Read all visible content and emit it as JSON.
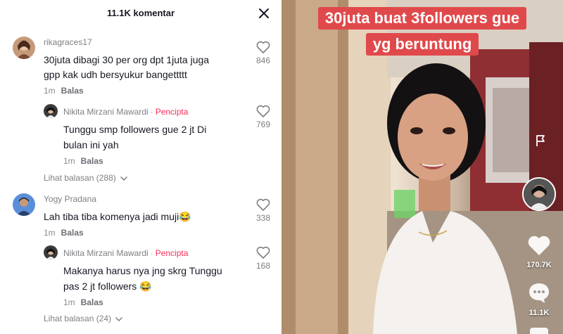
{
  "panel": {
    "title": "11.1K komentar"
  },
  "comments": [
    {
      "username": "rikagraces17",
      "text_line1": "30juta dibagi 30 per org dpt 1juta juga",
      "text_line2": "gpp kak udh bersyukur bangettttt",
      "age": "1m",
      "reply_label": "Balas",
      "likes": "846"
    },
    {
      "username": "Nikita Mirzani Mawardi",
      "creator_dot": "·",
      "creator_tag": "Pencipta",
      "text_line1": "Tunggu smp followers gue 2 jt Di",
      "text_line2": "bulan ini yah",
      "age": "1m",
      "reply_label": "Balas",
      "likes": "769"
    },
    {
      "view_replies": "Lihat balasan (288)"
    },
    {
      "username": "Yogy Pradana",
      "text_line1": "Lah tiba tiba komenya jadi muji😂",
      "age": "1m",
      "reply_label": "Balas",
      "likes": "338"
    },
    {
      "username": "Nikita Mirzani Mawardi",
      "creator_dot": "·",
      "creator_tag": "Pencipta",
      "text_line1": "Makanya harus nya jng skrg Tunggu",
      "text_line2": "pas 2 jt followers 😂",
      "age": "1m",
      "reply_label": "Balas",
      "likes": "168"
    },
    {
      "view_replies": "Lihat balasan (24)"
    }
  ],
  "video": {
    "caption_line1": "30juta buat 3followers gue",
    "caption_line2": "yg beruntung",
    "like_count": "170.7K",
    "comment_count": "11.1K"
  },
  "colors": {
    "accent": "#fe2c55",
    "caption_bg": "#e0494b"
  }
}
